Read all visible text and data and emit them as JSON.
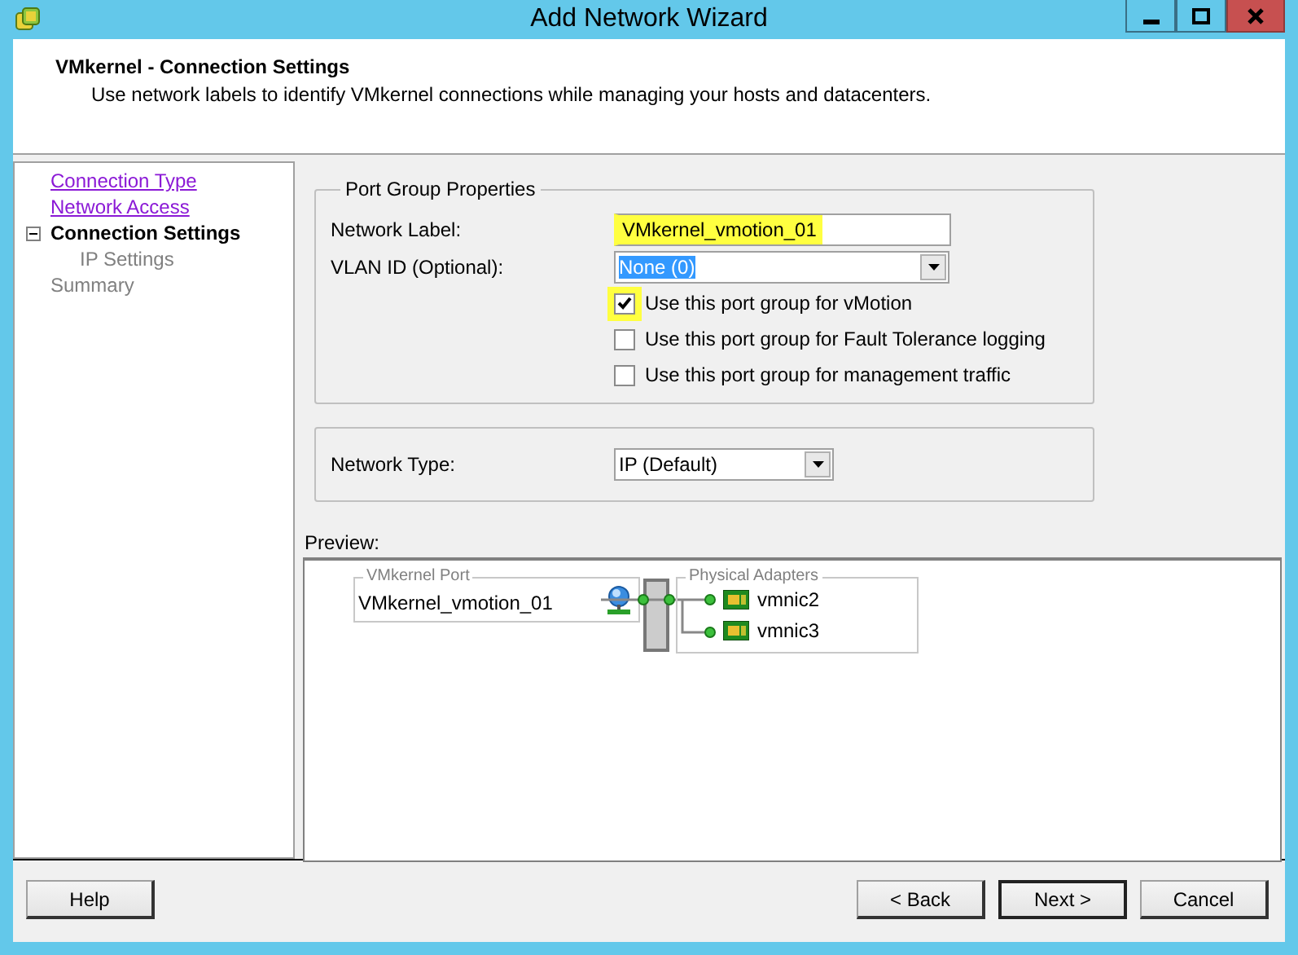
{
  "window": {
    "title": "Add Network Wizard"
  },
  "header": {
    "title": "VMkernel - Connection Settings",
    "subtitle": "Use network labels to identify VMkernel connections while managing your hosts and datacenters."
  },
  "nav": [
    {
      "label": "Connection Type",
      "kind": "visited"
    },
    {
      "label": "Network Access",
      "kind": "visited"
    },
    {
      "label": "Connection Settings",
      "kind": "current",
      "expanded": true,
      "children": [
        {
          "label": "IP Settings",
          "kind": "pending"
        }
      ]
    },
    {
      "label": "Summary",
      "kind": "pending"
    }
  ],
  "port_group": {
    "title": "Port Group Properties",
    "network_label": {
      "label": "Network Label:",
      "value": "VMkernel_vmotion_01",
      "highlighted": true
    },
    "vlan_id": {
      "label": "VLAN ID (Optional):",
      "value": "None (0)",
      "text_selected": true
    },
    "options": [
      {
        "label": "Use this port group for vMotion",
        "checked": true,
        "highlighted": true
      },
      {
        "label": "Use this port group for Fault Tolerance logging",
        "checked": false,
        "highlighted": false
      },
      {
        "label": "Use this port group for management traffic",
        "checked": false,
        "highlighted": false
      }
    ]
  },
  "network_type": {
    "label": "Network Type:",
    "value": "IP (Default)"
  },
  "preview": {
    "label": "Preview:",
    "port": {
      "title": "VMkernel Port",
      "name": "VMkernel_vmotion_01"
    },
    "adapters": {
      "title": "Physical Adapters",
      "items": [
        "vmnic2",
        "vmnic3"
      ]
    }
  },
  "buttons": [
    {
      "label": "Help",
      "default": false
    },
    {
      "label": "< Back",
      "default": false
    },
    {
      "label": "Next >",
      "default": true
    },
    {
      "label": "Cancel",
      "default": false
    }
  ]
}
